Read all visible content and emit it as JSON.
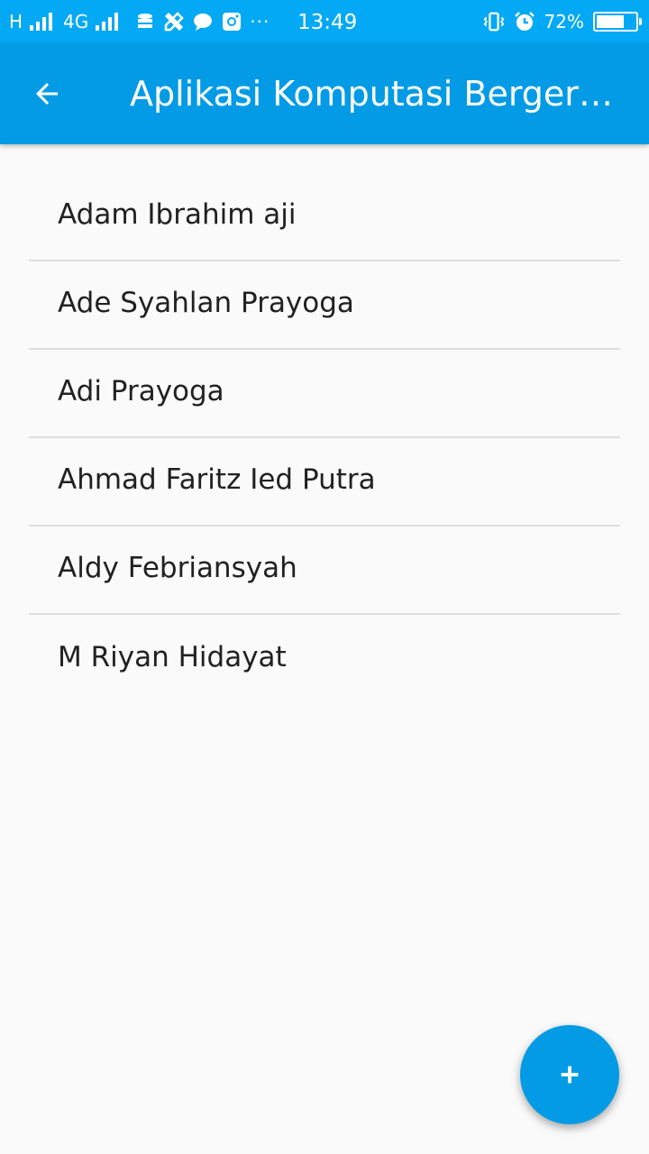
{
  "status_bar": {
    "network_1": "H",
    "network_2": "4G",
    "more": "···",
    "time": "13:49",
    "battery_percent_text": "72%",
    "battery_level": 0.72,
    "icons": [
      "signal-icon",
      "data-saver-icon",
      "tools-icon",
      "chat-icon",
      "instagram-icon",
      "vibrate-icon",
      "alarm-icon",
      "battery-icon"
    ]
  },
  "app_bar": {
    "title": "Aplikasi Komputasi Bergerak",
    "back_icon": "arrow-back-icon",
    "color": "#039be5"
  },
  "list": {
    "items": [
      {
        "label": "Adam Ibrahim aji"
      },
      {
        "label": "Ade Syahlan Prayoga"
      },
      {
        "label": "Adi Prayoga"
      },
      {
        "label": "Ahmad Faritz Ied Putra"
      },
      {
        "label": "Aldy Febriansyah"
      },
      {
        "label": "M Riyan Hidayat"
      }
    ]
  },
  "fab": {
    "icon": "plus-icon",
    "color": "#039be5"
  }
}
